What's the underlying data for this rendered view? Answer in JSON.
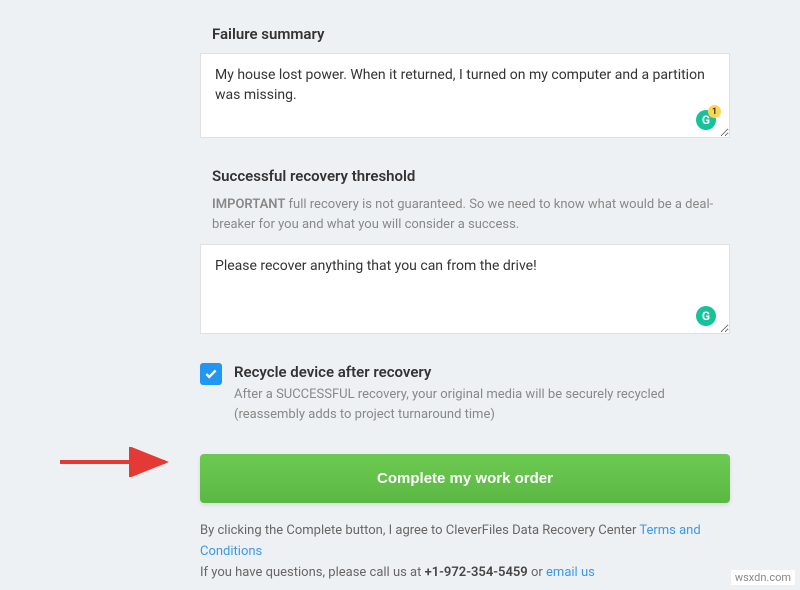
{
  "failure": {
    "label": "Failure summary",
    "value": "My house lost power. When it returned, I turned on my computer and a partition was missing.",
    "grammarly_count": "1"
  },
  "threshold": {
    "label": "Successful recovery threshold",
    "help_prefix": "IMPORTANT",
    "help_text": " full recovery is not guaranteed. So we need to know what would be a deal-breaker for you and what you will consider a success.",
    "value": "Please recover anything that you can from the drive!"
  },
  "recycle": {
    "label": "Recycle device after recovery",
    "desc": "After a SUCCESSFUL recovery, your original media will be securely recycled (reassembly adds to project turnaround time)",
    "checked": true
  },
  "submit": {
    "label": "Complete my work order"
  },
  "legal": {
    "line1_pre": "By clicking the Complete button, I agree to CleverFiles Data Recovery Center ",
    "terms_link": "Terms and Conditions",
    "line2_pre": "If you have questions, please call us at ",
    "phone": "+1-972-354-5459",
    "line2_mid": " or ",
    "email_link": "email us"
  },
  "watermark": "wsxdn.com"
}
